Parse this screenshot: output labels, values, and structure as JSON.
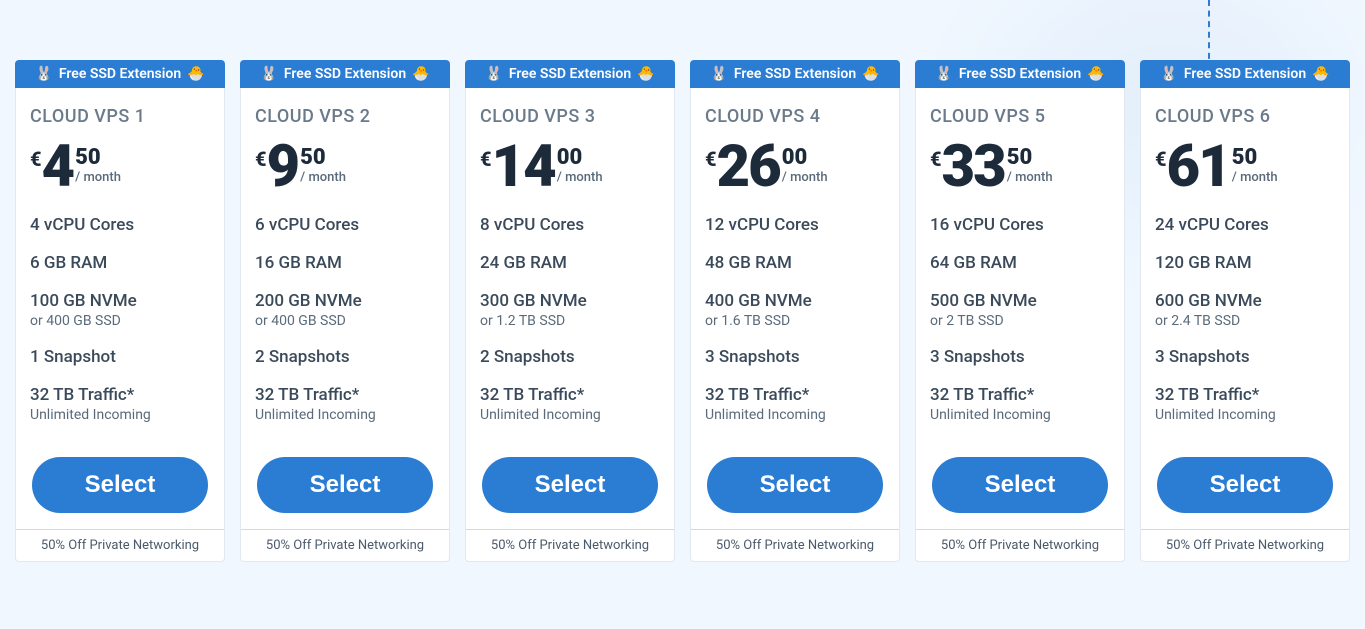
{
  "badge_prefix_emoji": "🐰",
  "badge_suffix_emoji": "🐣",
  "badge_text": "Free SSD Extension",
  "currency": "€",
  "interval": "/ month",
  "cta_label": "Select",
  "bottom_note": "50% Off Private Networking",
  "plans": [
    {
      "title": "CLOUD VPS 1",
      "price_whole": "4",
      "price_cents": "50",
      "cpu": "4 vCPU Cores",
      "ram": "6 GB RAM",
      "storage_main": "100 GB NVMe",
      "storage_alt": "or 400 GB SSD",
      "snapshots": "1 Snapshot",
      "traffic_main": "32 TB Traffic*",
      "traffic_sub": "Unlimited Incoming"
    },
    {
      "title": "CLOUD VPS 2",
      "price_whole": "9",
      "price_cents": "50",
      "cpu": "6 vCPU Cores",
      "ram": "16 GB RAM",
      "storage_main": "200 GB NVMe",
      "storage_alt": "or 400 GB SSD",
      "snapshots": "2 Snapshots",
      "traffic_main": "32 TB Traffic*",
      "traffic_sub": "Unlimited Incoming"
    },
    {
      "title": "CLOUD VPS 3",
      "price_whole": "14",
      "price_cents": "00",
      "cpu": "8 vCPU Cores",
      "ram": "24 GB RAM",
      "storage_main": "300 GB NVMe",
      "storage_alt": "or 1.2 TB SSD",
      "snapshots": "2 Snapshots",
      "traffic_main": "32 TB Traffic*",
      "traffic_sub": "Unlimited Incoming"
    },
    {
      "title": "CLOUD VPS 4",
      "price_whole": "26",
      "price_cents": "00",
      "cpu": "12 vCPU Cores",
      "ram": "48 GB RAM",
      "storage_main": "400 GB NVMe",
      "storage_alt": "or 1.6 TB SSD",
      "snapshots": "3 Snapshots",
      "traffic_main": "32 TB Traffic*",
      "traffic_sub": "Unlimited Incoming"
    },
    {
      "title": "CLOUD VPS 5",
      "price_whole": "33",
      "price_cents": "50",
      "cpu": "16 vCPU Cores",
      "ram": "64 GB RAM",
      "storage_main": "500 GB NVMe",
      "storage_alt": "or 2 TB SSD",
      "snapshots": "3 Snapshots",
      "traffic_main": "32 TB Traffic*",
      "traffic_sub": "Unlimited Incoming"
    },
    {
      "title": "CLOUD VPS 6",
      "price_whole": "61",
      "price_cents": "50",
      "cpu": "24 vCPU Cores",
      "ram": "120 GB RAM",
      "storage_main": "600 GB NVMe",
      "storage_alt": "or 2.4 TB SSD",
      "snapshots": "3 Snapshots",
      "traffic_main": "32 TB Traffic*",
      "traffic_sub": "Unlimited Incoming"
    }
  ]
}
